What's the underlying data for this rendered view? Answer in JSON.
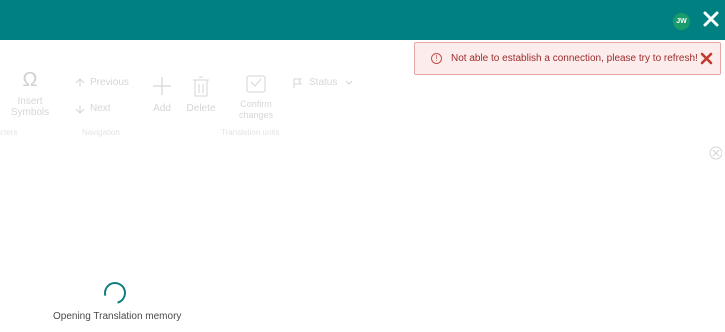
{
  "header": {
    "avatar_initials": "JW",
    "brand_color": "#008080"
  },
  "ribbon": {
    "insert_symbols_label": "Insert Symbols",
    "characters_group": "cters",
    "previous_label": "Previous",
    "next_label": "Next",
    "navigation_group": "Navigation",
    "add_label": "Add",
    "delete_label": "Delete",
    "confirm_changes_label": "Confirm changes",
    "translation_units_group": "Translation units",
    "status_label": "Status"
  },
  "error_banner": {
    "message": "Not able to establish a connection, please try to refresh!",
    "color": "#c0504d"
  },
  "loading": {
    "message": "Opening Translation memory"
  }
}
